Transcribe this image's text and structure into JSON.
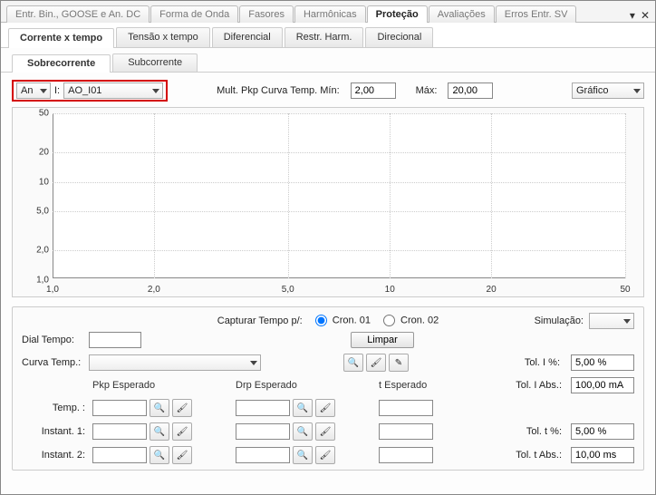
{
  "topTabs": {
    "t1": "Entr. Bin., GOOSE e An. DC",
    "t2": "Forma de Onda",
    "t3": "Fasores",
    "t4": "Harmônicas",
    "t5": "Proteção",
    "t6": "Avaliações",
    "t7": "Erros Entr. SV"
  },
  "subTabs": {
    "s1": "Corrente x tempo",
    "s2": "Tensão x tempo",
    "s3": "Diferencial",
    "s4": "Restr. Harm.",
    "s5": "Direcional"
  },
  "subTabs2": {
    "a": "Sobrecorrente",
    "b": "Subcorrente"
  },
  "row1": {
    "anLabel": "An",
    "iLabel": "I:",
    "iValue": "AO_I01",
    "multLabel": "Mult. Pkp Curva Temp. Mín:",
    "minVal": "2,00",
    "maxLabel": "Máx:",
    "maxVal": "20,00",
    "graficoLabel": "Gráfico"
  },
  "chart_data": {
    "type": "line",
    "title": "",
    "xlabel": "",
    "ylabel": "",
    "x_ticks": [
      "1,0",
      "2,0",
      "5,0",
      "10",
      "20",
      "50"
    ],
    "y_ticks": [
      "1,0",
      "2,0",
      "5,0",
      "10",
      "20",
      "50"
    ],
    "xscale": "log",
    "yscale": "log",
    "series": []
  },
  "bottom": {
    "capturarLabel": "Capturar Tempo p/:",
    "cron01": "Cron. 01",
    "cron02": "Cron. 02",
    "simulLabel": "Simulação:",
    "dialTempoLabel": "Dial Tempo:",
    "limparLabel": "Limpar",
    "curvaTempLabel": "Curva Temp.:",
    "pkpHeader": "Pkp Esperado",
    "drpHeader": "Drp Esperado",
    "tHeader": "t Esperado",
    "tempLabel": "Temp. :",
    "inst1Label": "Instant. 1:",
    "inst2Label": "Instant. 2:",
    "tolIPctLabel": "Tol. I %:",
    "tolIPctVal": "5,00 %",
    "tolIAbsLabel": "Tol. I Abs.:",
    "tolIAbsVal": "100,00 mA",
    "tolTPctLabel": "Tol. t %:",
    "tolTPctVal": "5,00 %",
    "tolTAbsLabel": "Tol. t Abs.:",
    "tolTAbsVal": "10,00 ms"
  }
}
